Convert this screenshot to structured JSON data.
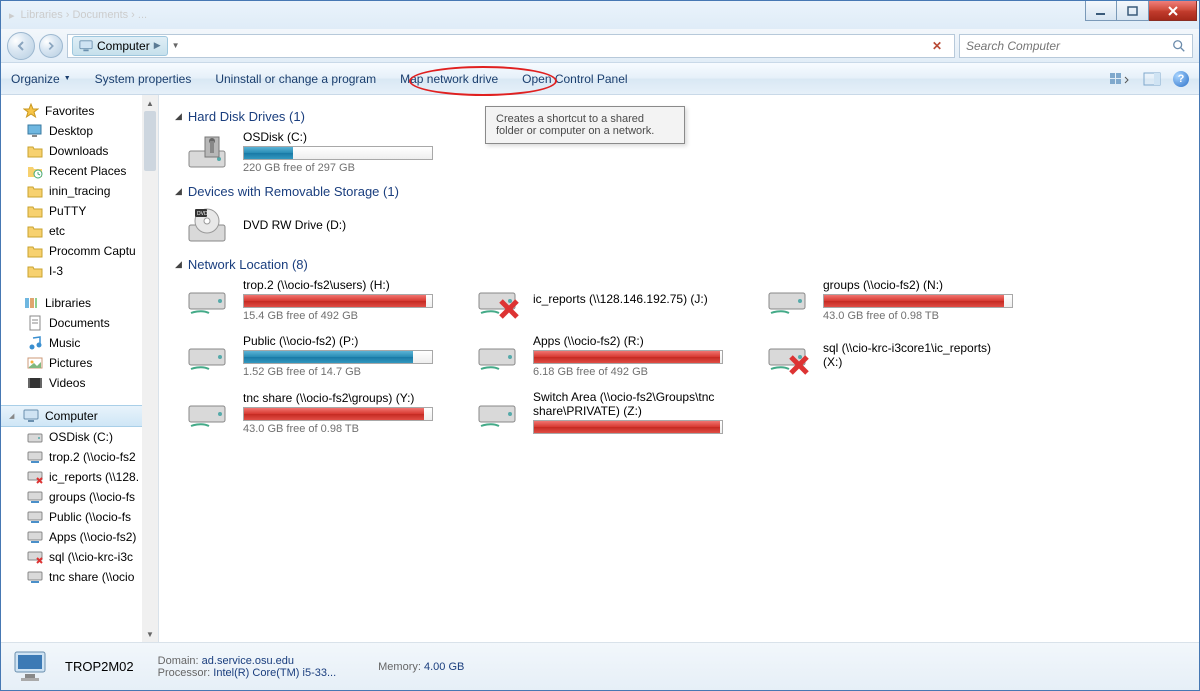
{
  "titlebar": {
    "path_hint": "Libraries › Documents › ..."
  },
  "nav": {
    "breadcrumb": {
      "segment": "Computer"
    },
    "search_placeholder": "Search Computer"
  },
  "toolbar": {
    "organize": "Organize",
    "sysprops": "System properties",
    "uninstall": "Uninstall or change a program",
    "mapdrive": "Map network drive",
    "controlpanel": "Open Control Panel"
  },
  "tooltip": "Creates a shortcut to a shared folder or computer on a network.",
  "sidebar": {
    "favorites_label": "Favorites",
    "favorites": [
      {
        "label": "Desktop",
        "icon": "desktop"
      },
      {
        "label": "Downloads",
        "icon": "folder"
      },
      {
        "label": "Recent Places",
        "icon": "recent"
      },
      {
        "label": "inin_tracing",
        "icon": "folder"
      },
      {
        "label": "PuTTY",
        "icon": "folder"
      },
      {
        "label": "etc",
        "icon": "folder"
      },
      {
        "label": "Procomm Captu",
        "icon": "folder"
      },
      {
        "label": "I-3",
        "icon": "folder"
      }
    ],
    "libraries_label": "Libraries",
    "libraries": [
      {
        "label": "Documents",
        "icon": "doc"
      },
      {
        "label": "Music",
        "icon": "music"
      },
      {
        "label": "Pictures",
        "icon": "pic"
      },
      {
        "label": "Videos",
        "icon": "video"
      }
    ],
    "computer_label": "Computer",
    "computer_items": [
      {
        "label": "OSDisk (C:)",
        "icon": "hdd"
      },
      {
        "label": "trop.2 (\\\\ocio-fs2",
        "icon": "netdrive"
      },
      {
        "label": "ic_reports (\\\\128.",
        "icon": "netbad"
      },
      {
        "label": "groups (\\\\ocio-fs",
        "icon": "netdrive"
      },
      {
        "label": "Public (\\\\ocio-fs",
        "icon": "netdrive"
      },
      {
        "label": "Apps (\\\\ocio-fs2)",
        "icon": "netdrive"
      },
      {
        "label": "sql (\\\\cio-krc-i3c",
        "icon": "netbad"
      },
      {
        "label": "tnc share (\\\\ocio",
        "icon": "netdrive"
      }
    ]
  },
  "sections": {
    "hdd_head": "Hard Disk Drives (1)",
    "removable_head": "Devices with Removable Storage (1)",
    "network_head": "Network Location (8)"
  },
  "hdd": {
    "name": "OSDisk (C:)",
    "free": "220 GB free of 297 GB",
    "fill_pct": 26,
    "color": "blue"
  },
  "dvd": {
    "name": "DVD RW Drive (D:)"
  },
  "network": [
    {
      "name": "trop.2 (\\\\ocio-fs2\\users) (H:)",
      "free": "15.4 GB free of 492 GB",
      "fill_pct": 97,
      "color": "red",
      "bar": true
    },
    {
      "name": "ic_reports (\\\\128.146.192.75) (J:)",
      "bar": false,
      "disconnected": true
    },
    {
      "name": "groups (\\\\ocio-fs2) (N:)",
      "free": "43.0 GB free of 0.98 TB",
      "fill_pct": 96,
      "color": "red",
      "bar": true
    },
    {
      "name": "Public (\\\\ocio-fs2) (P:)",
      "free": "1.52 GB free of 14.7 GB",
      "fill_pct": 90,
      "color": "blue",
      "bar": true
    },
    {
      "name": "Apps (\\\\ocio-fs2) (R:)",
      "free": "6.18 GB free of 492 GB",
      "fill_pct": 99,
      "color": "red",
      "bar": true
    },
    {
      "name": "sql (\\\\cio-krc-i3core1\\ic_reports) (X:)",
      "bar": false,
      "disconnected": true
    },
    {
      "name": "tnc share (\\\\ocio-fs2\\groups) (Y:)",
      "free": "43.0 GB free of 0.98 TB",
      "fill_pct": 96,
      "color": "red",
      "bar": true
    },
    {
      "name": "Switch Area (\\\\ocio-fs2\\Groups\\tnc share\\PRIVATE) (Z:)",
      "free": "",
      "fill_pct": 99,
      "color": "red",
      "bar": true
    }
  ],
  "details": {
    "name": "TROP2M02",
    "domain_lbl": "Domain:",
    "domain": "ad.service.osu.edu",
    "mem_lbl": "Memory:",
    "mem": "4.00 GB",
    "proc_lbl": "Processor:",
    "proc": "Intel(R) Core(TM) i5-33..."
  }
}
